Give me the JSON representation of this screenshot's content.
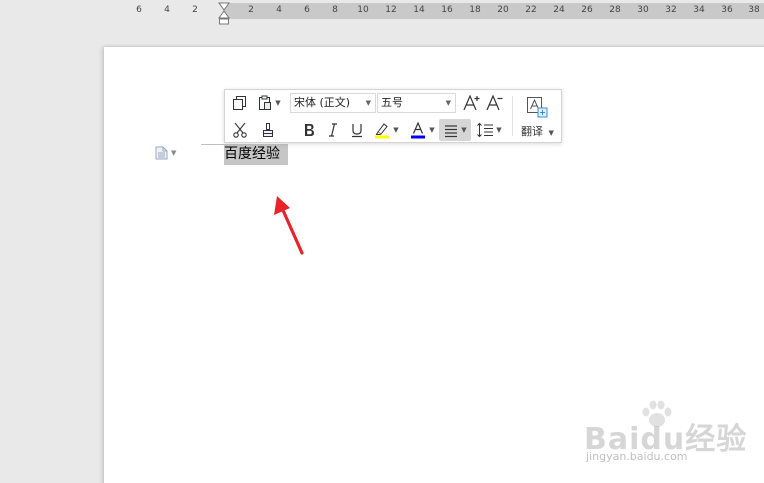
{
  "ruler": {
    "ticks": [
      "6",
      "4",
      "2",
      "2",
      "4",
      "6",
      "8",
      "10",
      "12",
      "14",
      "16",
      "18",
      "20",
      "22",
      "24",
      "26",
      "28",
      "30",
      "32",
      "34",
      "36",
      "38"
    ]
  },
  "document": {
    "selected_text": "百度经验"
  },
  "toolbar": {
    "font_name": "宋体 (正文)",
    "font_size": "五号",
    "translate_label": "翻译"
  },
  "watermark": {
    "brand": "Baidu经验",
    "url": "jingyan.baidu.com"
  },
  "colors": {
    "highlight_bar": "#ffff00",
    "font_color_bar": "#0000ff",
    "selection_bg": "#c6c6c6",
    "arrow": "#e8232a"
  },
  "icons": {
    "copy": "copy-icon",
    "paste": "paste-icon",
    "cut": "cut-icon",
    "format_painter": "format-painter-icon",
    "bold": "bold-icon",
    "italic": "italic-icon",
    "underline": "underline-icon",
    "highlight": "highlight-icon",
    "font_color": "font-color-icon",
    "align": "align-icon",
    "line_spacing": "line-spacing-icon",
    "grow_font": "grow-font-icon",
    "shrink_font": "shrink-font-icon",
    "translate": "translate-icon",
    "paragraph_handle": "paragraph-handle-icon"
  }
}
